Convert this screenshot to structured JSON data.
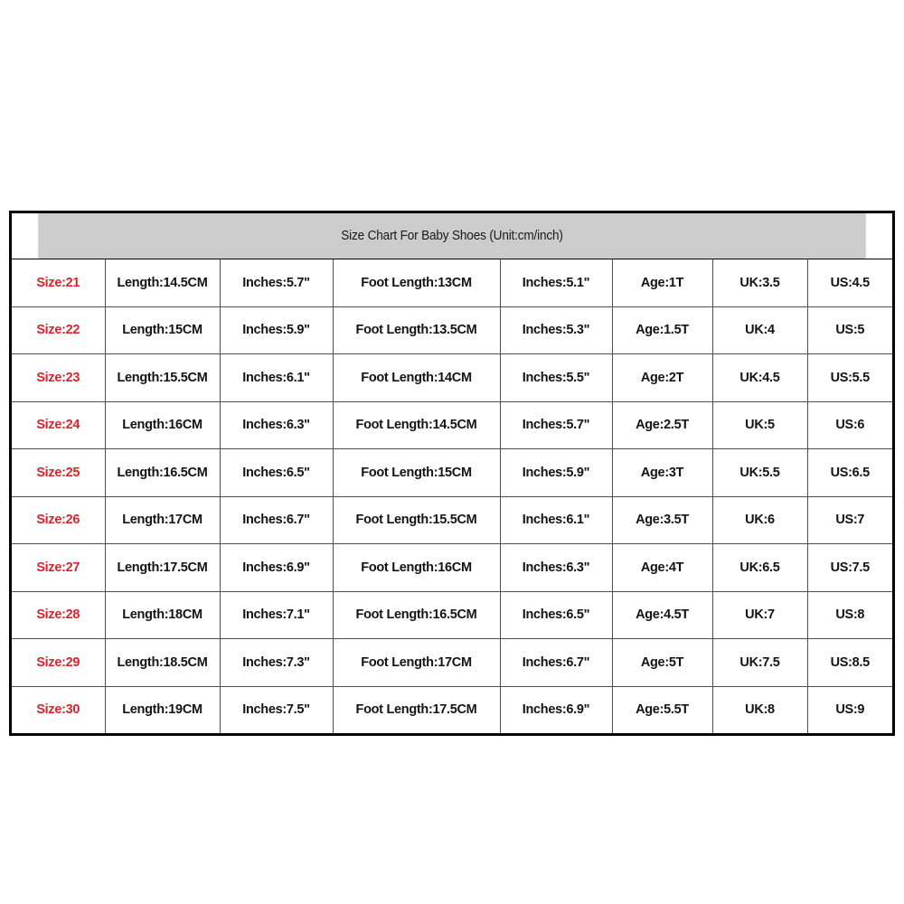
{
  "chart": {
    "title": "Size Chart For Baby Shoes (Unit:cm/inch)",
    "accent_color": "#e12229",
    "header_background": "#cccccc",
    "columns": [
      "Size",
      "Length",
      "Inches",
      "Foot Length",
      "Inches",
      "Age",
      "UK",
      "US"
    ],
    "rows": [
      {
        "size": "Size:21",
        "length": "Length:14.5CM",
        "length_inches": "Inches:5.7\"",
        "foot_length": "Foot Length:13CM",
        "foot_inches": "Inches:5.1\"",
        "age": "Age:1T",
        "uk": "UK:3.5",
        "us": "US:4.5"
      },
      {
        "size": "Size:22",
        "length": "Length:15CM",
        "length_inches": "Inches:5.9\"",
        "foot_length": "Foot Length:13.5CM",
        "foot_inches": "Inches:5.3\"",
        "age": "Age:1.5T",
        "uk": "UK:4",
        "us": "US:5"
      },
      {
        "size": "Size:23",
        "length": "Length:15.5CM",
        "length_inches": "Inches:6.1\"",
        "foot_length": "Foot Length:14CM",
        "foot_inches": "Inches:5.5\"",
        "age": "Age:2T",
        "uk": "UK:4.5",
        "us": "US:5.5"
      },
      {
        "size": "Size:24",
        "length": "Length:16CM",
        "length_inches": "Inches:6.3\"",
        "foot_length": "Foot Length:14.5CM",
        "foot_inches": "Inches:5.7\"",
        "age": "Age:2.5T",
        "uk": "UK:5",
        "us": "US:6"
      },
      {
        "size": "Size:25",
        "length": "Length:16.5CM",
        "length_inches": "Inches:6.5\"",
        "foot_length": "Foot Length:15CM",
        "foot_inches": "Inches:5.9\"",
        "age": "Age:3T",
        "uk": "UK:5.5",
        "us": "US:6.5"
      },
      {
        "size": "Size:26",
        "length": "Length:17CM",
        "length_inches": "Inches:6.7\"",
        "foot_length": "Foot Length:15.5CM",
        "foot_inches": "Inches:6.1\"",
        "age": "Age:3.5T",
        "uk": "UK:6",
        "us": "US:7"
      },
      {
        "size": "Size:27",
        "length": "Length:17.5CM",
        "length_inches": "Inches:6.9\"",
        "foot_length": "Foot Length:16CM",
        "foot_inches": "Inches:6.3\"",
        "age": "Age:4T",
        "uk": "UK:6.5",
        "us": "US:7.5"
      },
      {
        "size": "Size:28",
        "length": "Length:18CM",
        "length_inches": "Inches:7.1\"",
        "foot_length": "Foot Length:16.5CM",
        "foot_inches": "Inches:6.5\"",
        "age": "Age:4.5T",
        "uk": "UK:7",
        "us": "US:8"
      },
      {
        "size": "Size:29",
        "length": "Length:18.5CM",
        "length_inches": "Inches:7.3\"",
        "foot_length": "Foot Length:17CM",
        "foot_inches": "Inches:6.7\"",
        "age": "Age:5T",
        "uk": "UK:7.5",
        "us": "US:8.5"
      },
      {
        "size": "Size:30",
        "length": "Length:19CM",
        "length_inches": "Inches:7.5\"",
        "foot_length": "Foot Length:17.5CM",
        "foot_inches": "Inches:6.9\"",
        "age": "Age:5.5T",
        "uk": "UK:8",
        "us": "US:9"
      }
    ]
  },
  "chart_data": {
    "type": "table",
    "title": "Size Chart For Baby Shoes (Unit:cm/inch)",
    "columns": [
      "Size",
      "Length (CM)",
      "Inches",
      "Foot Length (CM)",
      "Inches",
      "Age",
      "UK",
      "US"
    ],
    "values": [
      [
        21,
        14.5,
        5.7,
        13,
        5.1,
        "1T",
        3.5,
        4.5
      ],
      [
        22,
        15,
        5.9,
        13.5,
        5.3,
        "1.5T",
        4,
        5
      ],
      [
        23,
        15.5,
        6.1,
        14,
        5.5,
        "2T",
        4.5,
        5.5
      ],
      [
        24,
        16,
        6.3,
        14.5,
        5.7,
        "2.5T",
        5,
        6
      ],
      [
        25,
        16.5,
        6.5,
        15,
        5.9,
        "3T",
        5.5,
        6.5
      ],
      [
        26,
        17,
        6.7,
        15.5,
        6.1,
        "3.5T",
        6,
        7
      ],
      [
        27,
        17.5,
        6.9,
        16,
        6.3,
        "4T",
        6.5,
        7.5
      ],
      [
        28,
        18,
        7.1,
        16.5,
        6.5,
        "4.5T",
        7,
        8
      ],
      [
        29,
        18.5,
        7.3,
        17,
        6.7,
        "5T",
        7.5,
        8.5
      ],
      [
        30,
        19,
        7.5,
        17.5,
        6.9,
        "5.5T",
        8,
        9
      ]
    ]
  }
}
